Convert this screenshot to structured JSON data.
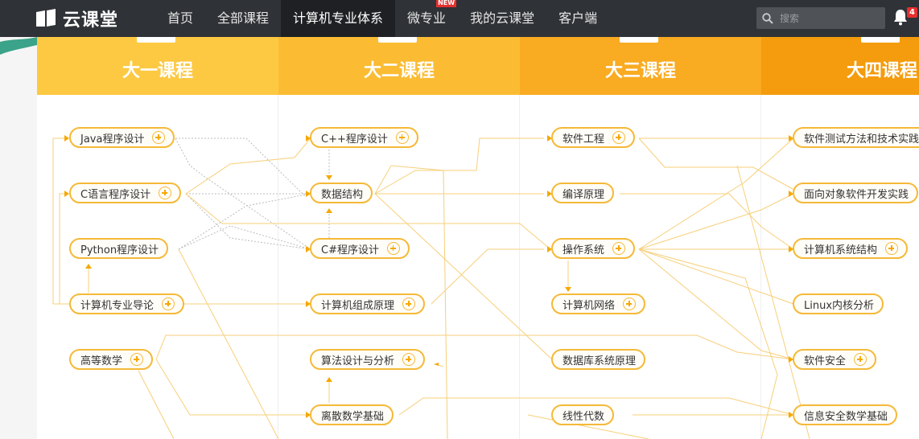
{
  "header": {
    "logo_text": "云课堂",
    "nav": [
      {
        "label": "首页"
      },
      {
        "label": "全部课程"
      },
      {
        "label": "计算机专业体系",
        "active": true
      },
      {
        "label": "微专业",
        "badge": "NEW"
      },
      {
        "label": "我的云课堂"
      },
      {
        "label": "客户端"
      }
    ],
    "search_placeholder": "搜索",
    "notification_count": "4"
  },
  "columns": [
    {
      "title": "大一课程",
      "color": "#fdc942"
    },
    {
      "title": "大二课程",
      "color": "#fbbc33"
    },
    {
      "title": "大三课程",
      "color": "#f9ab22"
    },
    {
      "title": "大四课程",
      "color": "#f49c0d"
    }
  ],
  "courses": {
    "y1": [
      {
        "name": "Java程序设计",
        "plus": true
      },
      {
        "name": "C语言程序设计",
        "plus": true
      },
      {
        "name": "Python程序设计",
        "plus": false
      },
      {
        "name": "计算机专业导论",
        "plus": true
      },
      {
        "name": "高等数学",
        "plus": true
      }
    ],
    "y2": [
      {
        "name": "C++程序设计",
        "plus": true
      },
      {
        "name": "数据结构",
        "plus": false
      },
      {
        "name": "C#程序设计",
        "plus": true
      },
      {
        "name": "计算机组成原理",
        "plus": true
      },
      {
        "name": "算法设计与分析",
        "plus": true
      },
      {
        "name": "离散数学基础",
        "plus": false
      }
    ],
    "y3": [
      {
        "name": "软件工程",
        "plus": true
      },
      {
        "name": "编译原理",
        "plus": false
      },
      {
        "name": "操作系统",
        "plus": true
      },
      {
        "name": "计算机网络",
        "plus": true
      },
      {
        "name": "数据库系统原理",
        "plus": false
      },
      {
        "name": "线性代数",
        "plus": false
      }
    ],
    "y4": [
      {
        "name": "软件测试方法和技术实践",
        "plus": false
      },
      {
        "name": "面向对象软件开发实践",
        "plus": false
      },
      {
        "name": "计算机系统结构",
        "plus": true
      },
      {
        "name": "Linux内核分析",
        "plus": false
      },
      {
        "name": "软件安全",
        "plus": true
      },
      {
        "name": "信息安全数学基础",
        "plus": false
      }
    ]
  },
  "colors": {
    "accent": "#f5b938",
    "line": "#f5b938",
    "topbar": "#2f3236"
  }
}
